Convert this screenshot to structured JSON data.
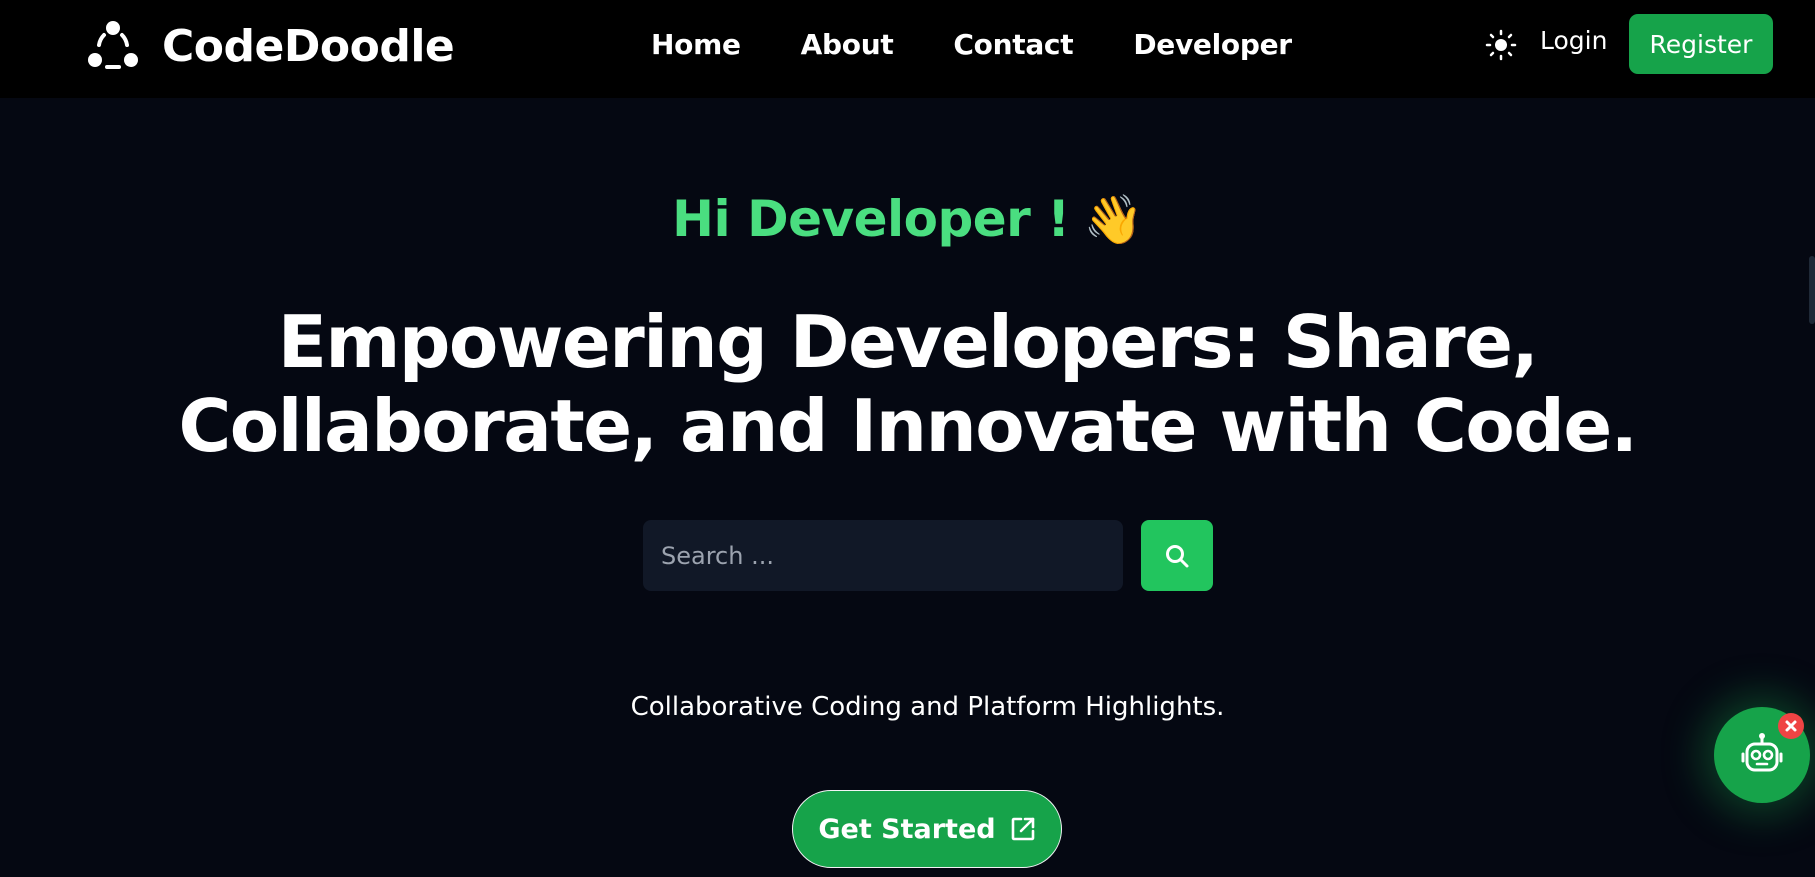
{
  "brand": {
    "name": "CodeDoodle"
  },
  "nav": {
    "links": [
      "Home",
      "About",
      "Contact",
      "Developer"
    ],
    "login_label": "Login",
    "register_label": "Register"
  },
  "hero": {
    "greeting": "Hi Developer !",
    "greeting_emoji": "👋",
    "headline_line1": "Empowering Developers: Share,",
    "headline_line2": "Collaborate, and Innovate with Code.",
    "search_placeholder": "Search ...",
    "highlights": "Collaborative Coding and Platform Highlights.",
    "cta_label": "Get Started"
  },
  "icons": {
    "logo": "share-nodes-icon",
    "theme": "sun-icon",
    "search": "search-icon",
    "cta": "external-link-icon",
    "chatbot": "robot-icon",
    "close": "close-icon"
  },
  "colors": {
    "background": "#050812",
    "navbar": "#000000",
    "accent": "#16a34a",
    "accent_light": "#22c55e",
    "greeting": "#4ade80",
    "close_badge": "#ef4444"
  }
}
